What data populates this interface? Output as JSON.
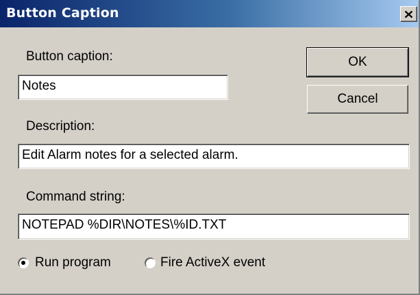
{
  "window": {
    "title": "Button Caption",
    "close_icon": "close-icon"
  },
  "form": {
    "caption_label": "Button caption:",
    "caption_value": "Notes",
    "description_label": "Description:",
    "description_value": "Edit Alarm notes for a selected alarm.",
    "command_label": "Command string:",
    "command_value": "NOTEPAD %DIR\\NOTES\\%ID.TXT"
  },
  "buttons": {
    "ok": "OK",
    "cancel": "Cancel"
  },
  "options": {
    "run_program": "Run program",
    "fire_activex": "Fire ActiveX event",
    "selected": "run_program"
  }
}
